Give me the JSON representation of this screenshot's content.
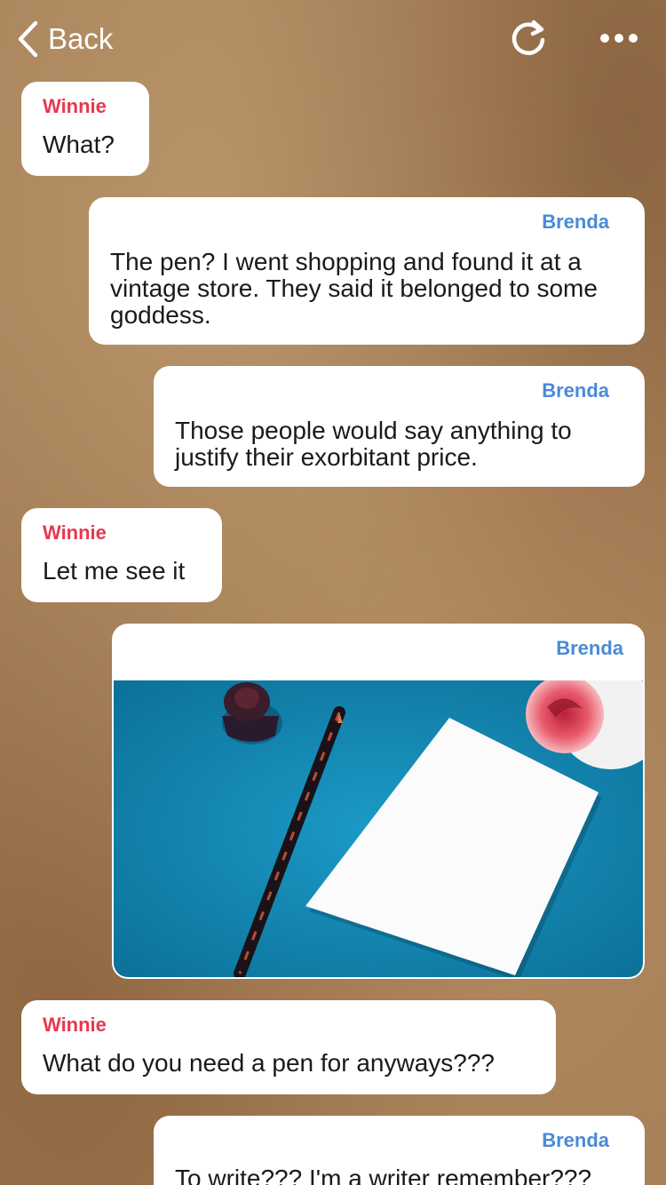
{
  "header": {
    "back_label": "Back",
    "refresh_icon": "refresh-icon",
    "more_icon": "more-dots-icon"
  },
  "colors": {
    "winnie": "#e8374f",
    "brenda": "#4a8ad6",
    "bubble": "#ffffff"
  },
  "messages": [
    {
      "sender": "Winnie",
      "text": "What?"
    },
    {
      "sender": "Brenda",
      "text": "The pen? I went shopping and found it at a vintage store. They said it belonged to some goddess."
    },
    {
      "sender": "Brenda",
      "text": "Those people would say anything to justify their exorbitant price."
    },
    {
      "sender": "Winnie",
      "text": "Let me see it"
    },
    {
      "sender": "Brenda",
      "text": "",
      "image": "photo-pen-inkwell-paper-rose"
    },
    {
      "sender": "Winnie",
      "text": "What do you need a pen for anyways???"
    },
    {
      "sender": "Brenda",
      "text": "To write??? I'm a writer remember???"
    }
  ]
}
